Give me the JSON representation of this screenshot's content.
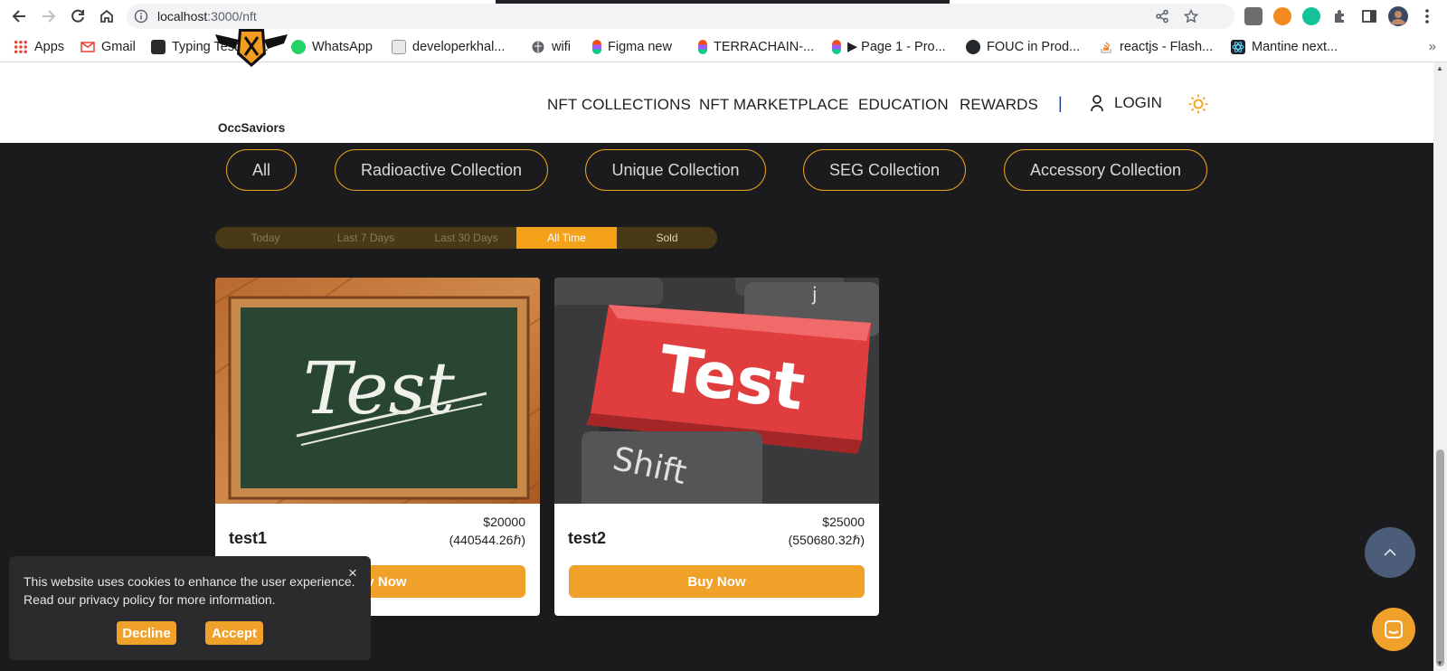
{
  "browser": {
    "url_host": "localhost",
    "url_rest": ":3000/nft",
    "bookmarks": [
      {
        "label": "Apps",
        "icon": "apps-grid-icon"
      },
      {
        "label": "Gmail",
        "icon": "gmail-icon"
      },
      {
        "label": "Typing Test En...",
        "icon": "typing-test-icon"
      },
      {
        "label": "WhatsApp",
        "icon": "whatsapp-icon"
      },
      {
        "label": "developerkhal...",
        "icon": "dev-icon"
      },
      {
        "label": "wifi",
        "icon": "globe-icon"
      },
      {
        "label": "Figma new",
        "icon": "figma-icon"
      },
      {
        "label": "TERRACHAIN-...",
        "icon": "figma-icon"
      },
      {
        "label": "▶ Page 1 - Pro...",
        "icon": "figma-icon"
      },
      {
        "label": "FOUC in Prod...",
        "icon": "github-icon"
      },
      {
        "label": "reactjs - Flash...",
        "icon": "stackoverflow-icon"
      },
      {
        "label": "Mantine next...",
        "icon": "react-icon"
      }
    ],
    "more": "»"
  },
  "header": {
    "logo_text": "OccSaviors",
    "nav": [
      "NFT COLLECTIONS",
      "NFT MARKETPLACE",
      "EDUCATION",
      "REWARDS"
    ],
    "separator": "|",
    "login": "LOGIN"
  },
  "collections": [
    "All",
    "Radioactive Collection",
    "Unique Collection",
    "SEG Collection",
    "Accessory Collection"
  ],
  "timeframes": {
    "options": [
      "Today",
      "Last 7 Days",
      "Last 30 Days",
      "All Time",
      "Sold"
    ],
    "selected": "All Time"
  },
  "cards": [
    {
      "name": "test1",
      "price": "$20000",
      "price_alt": "(440544.26ℏ)",
      "button": "Buy Now",
      "image_text": "Test"
    },
    {
      "name": "test2",
      "price": "$25000",
      "price_alt": "(550680.32ℏ)",
      "button": "Buy Now",
      "image_text": "Test",
      "image_subtext": "Shift"
    }
  ],
  "cookie": {
    "text": "This website uses cookies to enhance the user experience. Read our privacy policy for more information.",
    "close": "×",
    "decline": "Decline",
    "accept": "Accept"
  },
  "colors": {
    "accent": "#f0a12a",
    "background": "#1b1b1d",
    "scrolltop": "#4b5d78"
  }
}
